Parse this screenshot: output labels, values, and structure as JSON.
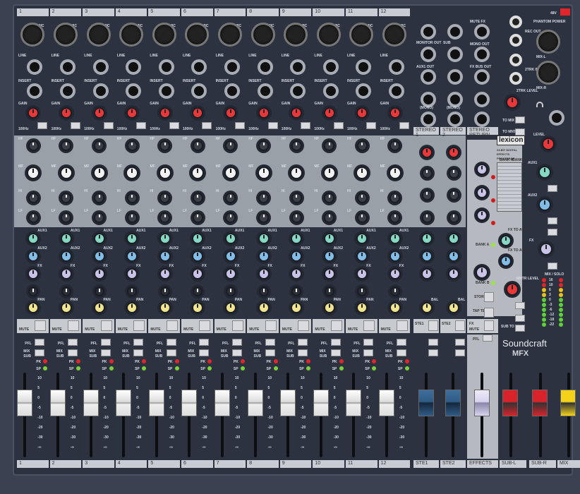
{
  "channels": {
    "numbers": [
      "1",
      "2",
      "3",
      "4",
      "5",
      "6",
      "7",
      "8",
      "9",
      "10",
      "11",
      "12"
    ],
    "mic": "MIC",
    "line": "LINE",
    "insert": "INSERT",
    "gain": "GAIN",
    "hpf": "100Hz",
    "eq": [
      "HF",
      "MF",
      "HI",
      "LF"
    ],
    "aux1": "AUX1",
    "aux2": "AUX2",
    "fx": "FX",
    "pan": "PAN",
    "mute": "MUTE",
    "pfl": "PFL",
    "mix": "MIX",
    "sub": "SUB",
    "pk": "PK",
    "sp": "SP",
    "scale": [
      "10",
      "5",
      "0",
      "-5",
      "-10",
      "-20",
      "-30",
      "-∞"
    ]
  },
  "stereo": {
    "labels": [
      "STE1",
      "STE2",
      "FX"
    ],
    "bal": "BAL",
    "sections": [
      "STEREO 1",
      "STEREO 2",
      "STEREO RETURN"
    ],
    "mono": "(MONO)"
  },
  "outputs": {
    "monitor_out": "MONITOR OUT",
    "sub": "SUB",
    "aux1_out": "AUX1 OUT",
    "mute_fx": "MUTE FX",
    "mono_out": "MONO OUT",
    "fx_bus_out": "FX BUS OUT",
    "rec_out": "REC OUT",
    "trk_in": "2TRK IN",
    "trk_level": "2TRK LEVEL",
    "to_mix": "TO MIX",
    "to_mntr": "TO MNTR",
    "phantom": "PHANTOM POWER",
    "v48": "48V",
    "mix_l": "MIX-L",
    "mix_r": "MIX-R",
    "level": "LEVEL"
  },
  "effects": {
    "brand": "lexicon",
    "subtitle": "24-BIT DIGITAL EFFECTS PROCESSOR",
    "bank_a": "BANK A",
    "bank_b": "BANK B",
    "store": "STORE",
    "tap": "TAP TEMPO",
    "mute": "MUTE",
    "pfl": "PFL",
    "to_aux1": "FX TO AUX1",
    "to_aux2": "FX TO AUX2",
    "mntr_level": "MNTR LEVEL",
    "sub_to_mix": "SUB TO MIX"
  },
  "meter": {
    "title": "MIX / SOLO",
    "scale": [
      "16",
      "10",
      "6",
      "3",
      "0",
      "-3",
      "-6",
      "-12",
      "-18",
      "-22"
    ]
  },
  "brand": {
    "name": "Soundcraft",
    "model": "MFX"
  },
  "bottom_labels": [
    "1",
    "2",
    "3",
    "4",
    "5",
    "6",
    "7",
    "8",
    "9",
    "10",
    "11",
    "12",
    "STE1",
    "STE2",
    "EFFECTS",
    "SUB-L",
    "SUB-R",
    "MIX"
  ],
  "colors": {
    "gain": "#e8383a",
    "aux1": "#86d8c4",
    "aux2": "#82bde8",
    "fx": "#c9c3e8",
    "pan": "#f0e48e",
    "eq": "#3a3f48",
    "mf": "#f2f2f2",
    "ste_fader": "#2f5b86",
    "fx_fader": "#d7d3ef",
    "sub_fader": "#d8232a",
    "mix_fader": "#f4d21a"
  }
}
